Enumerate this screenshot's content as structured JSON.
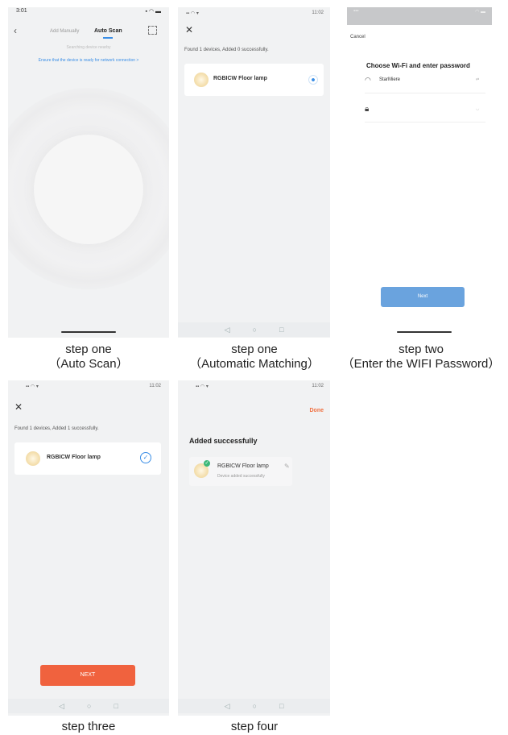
{
  "step_auto_scan": {
    "status_time": "3:01",
    "tab_manual": "Add Manually",
    "tab_scan": "Auto Scan",
    "searching": "Searching device nearby",
    "ensure_link": "Ensure that the device is ready for network connection >"
  },
  "step_matching": {
    "status_time": "11:02",
    "found_text": "Found 1 devices, Added 0 successfully.",
    "device_name": "RGBICW  Floor lamp"
  },
  "step_wifi": {
    "cancel": "Cancel",
    "title": "Choose Wi-Fi and enter password",
    "ssid": "StarMiere",
    "next": "Next"
  },
  "step_three": {
    "status_time": "11:02",
    "found_text": "Found 1 devices, Added 1 successfully.",
    "device_name": "RGBICW  Floor lamp",
    "next_button": "NEXT"
  },
  "step_four": {
    "status_time": "11:02",
    "done": "Done",
    "added_title": "Added successfully",
    "device_name": "RGBICW  Floor lamp",
    "device_sub": "Device added successfully"
  },
  "captions": {
    "c1_line1": "step one",
    "c1_line2": "（Auto Scan）",
    "c2_line1": "step one",
    "c2_line2": "（Automatic Matching）",
    "c3_line1": "step two",
    "c3_line2": "（Enter the WIFI Password）",
    "c4": "step three",
    "c5": "step four"
  },
  "colors": {
    "accent_blue": "#3a8ee6",
    "next_blue": "#6aa3de",
    "next_orange": "#f0623e",
    "done_orange": "#f07040",
    "check_green": "#3cb878"
  }
}
